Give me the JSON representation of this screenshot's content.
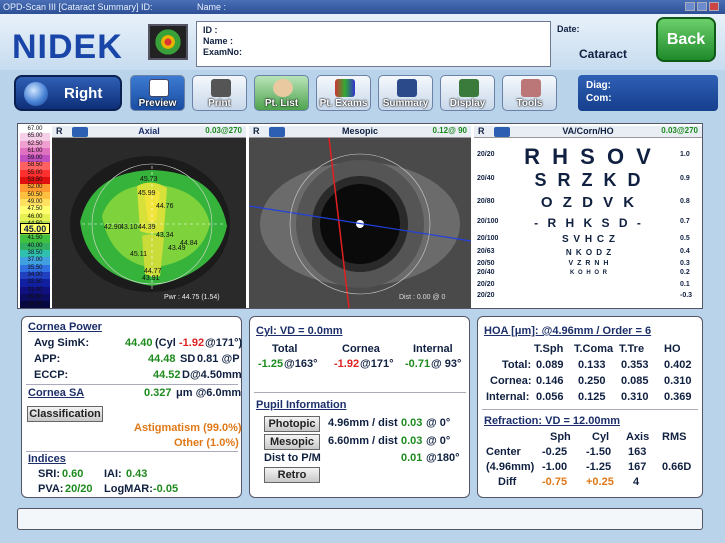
{
  "window": {
    "title": "OPD-Scan III  [Cataract Summary]  ID:",
    "name_label": "Name :"
  },
  "brand": {
    "logo": "NIDEK"
  },
  "patient": {
    "id_label": "ID :",
    "name_label": "Name :",
    "exam_label": "ExamNo:"
  },
  "date": {
    "label": "Date:",
    "mode": "Cataract"
  },
  "back_label": "Back",
  "eye_button": "Right",
  "toolbar": [
    {
      "label": "Preview",
      "icon": "preview-icon",
      "active": true
    },
    {
      "label": "Print",
      "icon": "print-icon",
      "active": false
    },
    {
      "label": "Pt. List",
      "icon": "patient-list-icon",
      "active": false
    },
    {
      "label": "Pt. Exams",
      "icon": "patient-exams-icon",
      "active": false
    },
    {
      "label": "Summary",
      "icon": "summary-icon",
      "active": false
    },
    {
      "label": "Display",
      "icon": "display-icon",
      "active": false
    },
    {
      "label": "Tools",
      "icon": "tools-icon",
      "active": false
    }
  ],
  "diag": {
    "diag_label": "Diag:",
    "com_label": "Com:"
  },
  "axial": {
    "eye": "R",
    "title": "Axial",
    "axis": "0.03@270",
    "current_scale": "45.00",
    "pwr": "Pwr : 44.75 (1.54)",
    "scale": [
      "67.00",
      "65.00",
      "62.50",
      "61.00",
      "59.00",
      "58.50",
      "55.00",
      "53.50",
      "52.00",
      "50.50",
      "49.00",
      "47.50",
      "46.00",
      "44.50",
      "43.00",
      "41.50",
      "40.00",
      "38.50",
      "37.00",
      "35.50",
      "34.00",
      "32.50",
      "31.00",
      "29.50",
      "28.00"
    ],
    "map_values": [
      "45.73",
      "45.99",
      "44.76",
      "42.90",
      "43.10",
      "44.39",
      "43.34",
      "45.11",
      "44.84",
      "43.49",
      "43.91",
      "44.77"
    ]
  },
  "mesopic": {
    "eye": "R",
    "title": "Mesopic",
    "axis": "0.12@ 90",
    "dist": "Dist : 0.00 @ 0"
  },
  "chart": {
    "eye": "R",
    "title": "VA/Corn/HO",
    "axis": "0.03@270",
    "rows": [
      {
        "left": "20/20",
        "letters": "R H S O V",
        "right": "1.0"
      },
      {
        "left": "20/40",
        "letters": "S R Z K D",
        "right": "0.9"
      },
      {
        "left": "20/80",
        "letters": "O Z D V K",
        "right": "0.8"
      },
      {
        "left": "20/100",
        "letters": "- R H K S D -",
        "right": "0.7"
      },
      {
        "left": "20/100",
        "letters": "S V H C Z",
        "right": "0.5"
      },
      {
        "left": "20/63",
        "letters": "N K O D Z",
        "right": "0.4"
      },
      {
        "left": "20/50",
        "letters": "V Z R N H",
        "right": "0.3"
      },
      {
        "left": "20/40",
        "letters": "K O H O R",
        "right": "0.2"
      },
      {
        "left": "20/20",
        "letters": "",
        "right": "0.1"
      },
      {
        "left": "20/20",
        "letters": "",
        "right": "-0.3"
      }
    ]
  },
  "cornea_power": {
    "title": "Cornea Power",
    "avg_simk_label": "Avg SimK:",
    "avg_simk": "44.40",
    "cyl_label": "(Cyl",
    "cyl": "-1.92",
    "cyl_axis": "@171°)",
    "app_label": "APP:",
    "app": "44.48",
    "sd_label": "SD",
    "sd": "0.81 @P",
    "eccp_label": "ECCP:",
    "eccp": "44.52",
    "eccp_suffix": "D@4.50mm"
  },
  "cornea_sa": {
    "title": "Cornea SA",
    "value": "0.327",
    "suffix": "μm @6.0mm"
  },
  "classification": {
    "button": "Classification",
    "line1": "Astigmatism (99.0%)",
    "line2": "Other (1.0%)"
  },
  "indices": {
    "title": "Indices",
    "sri_label": "SRI:",
    "sri": "0.60",
    "iai_label": "IAI:",
    "iai": "0.43",
    "pva_label": "PVA:",
    "pva": "20/20",
    "logmar_label": "LogMAR:",
    "logmar": "-0.05"
  },
  "cyl": {
    "title": "Cyl: VD = 0.0mm",
    "headers": [
      "Total",
      "Cornea",
      "Internal"
    ],
    "total_val": "-1.25",
    "total_axis": "@163°",
    "cornea_val": "-1.92",
    "cornea_axis": "@171°",
    "internal_val": "-0.71",
    "internal_axis": "@ 93°"
  },
  "pupil": {
    "title": "Pupil Information",
    "photopic": "Photopic",
    "photopic_size": "4.96mm / dist",
    "photopic_dist": "0.03",
    "photopic_axis": "@  0°",
    "mesopic": "Mesopic",
    "mesopic_size": "6.60mm / dist",
    "mesopic_dist": "0.03",
    "mesopic_axis": "@  0°",
    "dist_label": "Dist to P/M",
    "dist_val": "0.01",
    "dist_axis": "@180°",
    "retro": "Retro"
  },
  "hoa": {
    "title": "HOA [μm]: @4.96mm / Order = 6",
    "headers": [
      "T.Sph",
      "T.Coma",
      "T.Tre",
      "HO"
    ],
    "rows": [
      {
        "label": "Total:",
        "vals": [
          "0.089",
          "0.133",
          "0.353",
          "0.402"
        ]
      },
      {
        "label": "Cornea:",
        "vals": [
          "0.146",
          "0.250",
          "0.085",
          "0.310"
        ]
      },
      {
        "label": "Internal:",
        "vals": [
          "0.056",
          "0.125",
          "0.310",
          "0.369"
        ]
      }
    ]
  },
  "refraction": {
    "title": "Refraction: VD = 12.00mm",
    "headers": [
      "Sph",
      "Cyl",
      "Axis",
      "RMS"
    ],
    "center_label": "Center",
    "center": [
      "-0.25",
      "-1.50",
      "163",
      ""
    ],
    "pupil_label": "(4.96mm)",
    "pupil": [
      "-1.00",
      "-1.25",
      "167",
      "0.66D"
    ],
    "diff_label": "Diff",
    "diff": [
      "-0.75",
      "+0.25",
      "4",
      ""
    ]
  }
}
